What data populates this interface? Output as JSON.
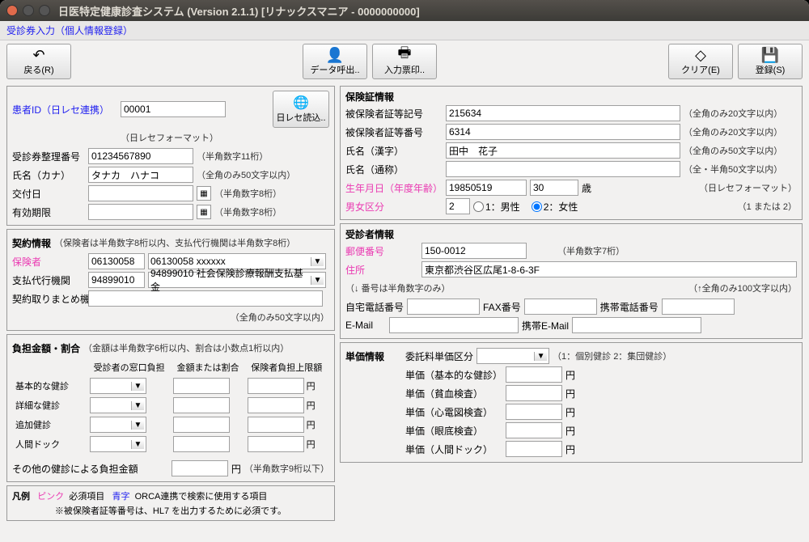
{
  "title": "日医特定健康診査システム (Version 2.1.1) [リナックスマニア - 0000000000]",
  "subtitle": "受診券入力（個人情報登録）",
  "toolbar": {
    "back": "戻る(R)",
    "load": "データ呼出..",
    "print": "入力票印..",
    "clear": "クリア(E)",
    "register": "登録(S)"
  },
  "left": {
    "patient_id_label": "患者ID（日レセ連携）",
    "patient_id": "00001",
    "orcabtn": "日レセ読込..",
    "format_note": "（日レセフォーマット）",
    "l_ticket": "受診券整理番号",
    "ticket": "01234567890",
    "ticket_note": "（半角数字11桁）",
    "l_kana": "氏名（カナ）",
    "kana": "タナカ　ハナコ",
    "kana_note": "（全角のみ50文字以内）",
    "l_issue": "交付日",
    "issue_note": "（半角数字8桁）",
    "l_expire": "有効期限",
    "expire_note": "（半角数字8桁）",
    "contract": {
      "title": "契約情報",
      "note": "（保険者は半角数字8桁以内、支払代行機関は半角数字8桁）",
      "l_insurer": "保険者",
      "insurer": "06130058",
      "insurer_sel": "06130058 xxxxxx",
      "l_agency": "支払代行機関",
      "agency": "94899010",
      "agency_sel": "94899010 社会保険診療報酬支払基金",
      "l_summary": "契約取りまとめ機関名",
      "summary_note": "（全角のみ50文字以内）"
    },
    "burden": {
      "title": "負担金額・割合",
      "note": "（金額は半角数字6桁以内、割合は小数点1桁以内）",
      "h1": "受診者の窓口負担",
      "h2": "金額または割合",
      "h3": "保険者負担上限額",
      "r1": "基本的な健診",
      "r2": "詳細な健診",
      "r3": "追加健診",
      "r4": "人間ドック",
      "yen": "円",
      "other_label": "その他の健診による負担金額",
      "other_note": "（半角数字9桁以下）"
    },
    "legend": {
      "title": "凡例",
      "pink": "ピンク",
      "pinktxt": "必須項目",
      "blue": "青字",
      "bluetxt": "ORCA連携で検索に使用する項目",
      "foot": "※被保険者証等番号は、HL7 を出力するために必須です。"
    }
  },
  "right": {
    "ins": {
      "title": "保険証情報",
      "l_sym": "被保険者証等記号",
      "sym": "215634",
      "sym_note": "（全角のみ20文字以内）",
      "l_num": "被保険者証等番号",
      "num": "6314",
      "num_note": "（全角のみ20文字以内）",
      "l_kanji": "氏名（漢字）",
      "kanji": "田中　花子",
      "kanji_note": "（全角のみ50文字以内）",
      "l_alias": "氏名（通称）",
      "alias_note": "（全・半角50文字以内）",
      "l_birth": "生年月日（年度年齢）",
      "birth": "19850519",
      "age": "30",
      "age_unit": "歳",
      "birth_note": "（日レセフォーマット）",
      "l_sex": "男女区分",
      "opt1": "1：男性",
      "opt2": "2：女性",
      "sex_note": "（1 または 2）"
    },
    "pat": {
      "title": "受診者情報",
      "l_zip": "郵便番号",
      "zip": "150-0012",
      "zip_note": "（半角数字7桁）",
      "l_addr": "住所",
      "addr": "東京都渋谷区広尾1-8-6-3F",
      "addr_sub": "（↓ 番号は半角数字のみ）",
      "addr_note": "（↑全角のみ100文字以内）",
      "l_tel": "自宅電話番号",
      "l_fax": "FAX番号",
      "l_mobile": "携帯電話番号",
      "l_email": "E-Mail",
      "l_memail": "携帯E-Mail"
    },
    "price": {
      "title": "単価情報",
      "l_type": "委託料単価区分",
      "type_note": "（1：個別健診 2：集団健診）",
      "l1": "単価（基本的な健診）",
      "l2": "単価（貧血検査）",
      "l3": "単価（心電図検査）",
      "l4": "単価（眼底検査）",
      "l5": "単価（人間ドック）",
      "yen": "円"
    }
  }
}
